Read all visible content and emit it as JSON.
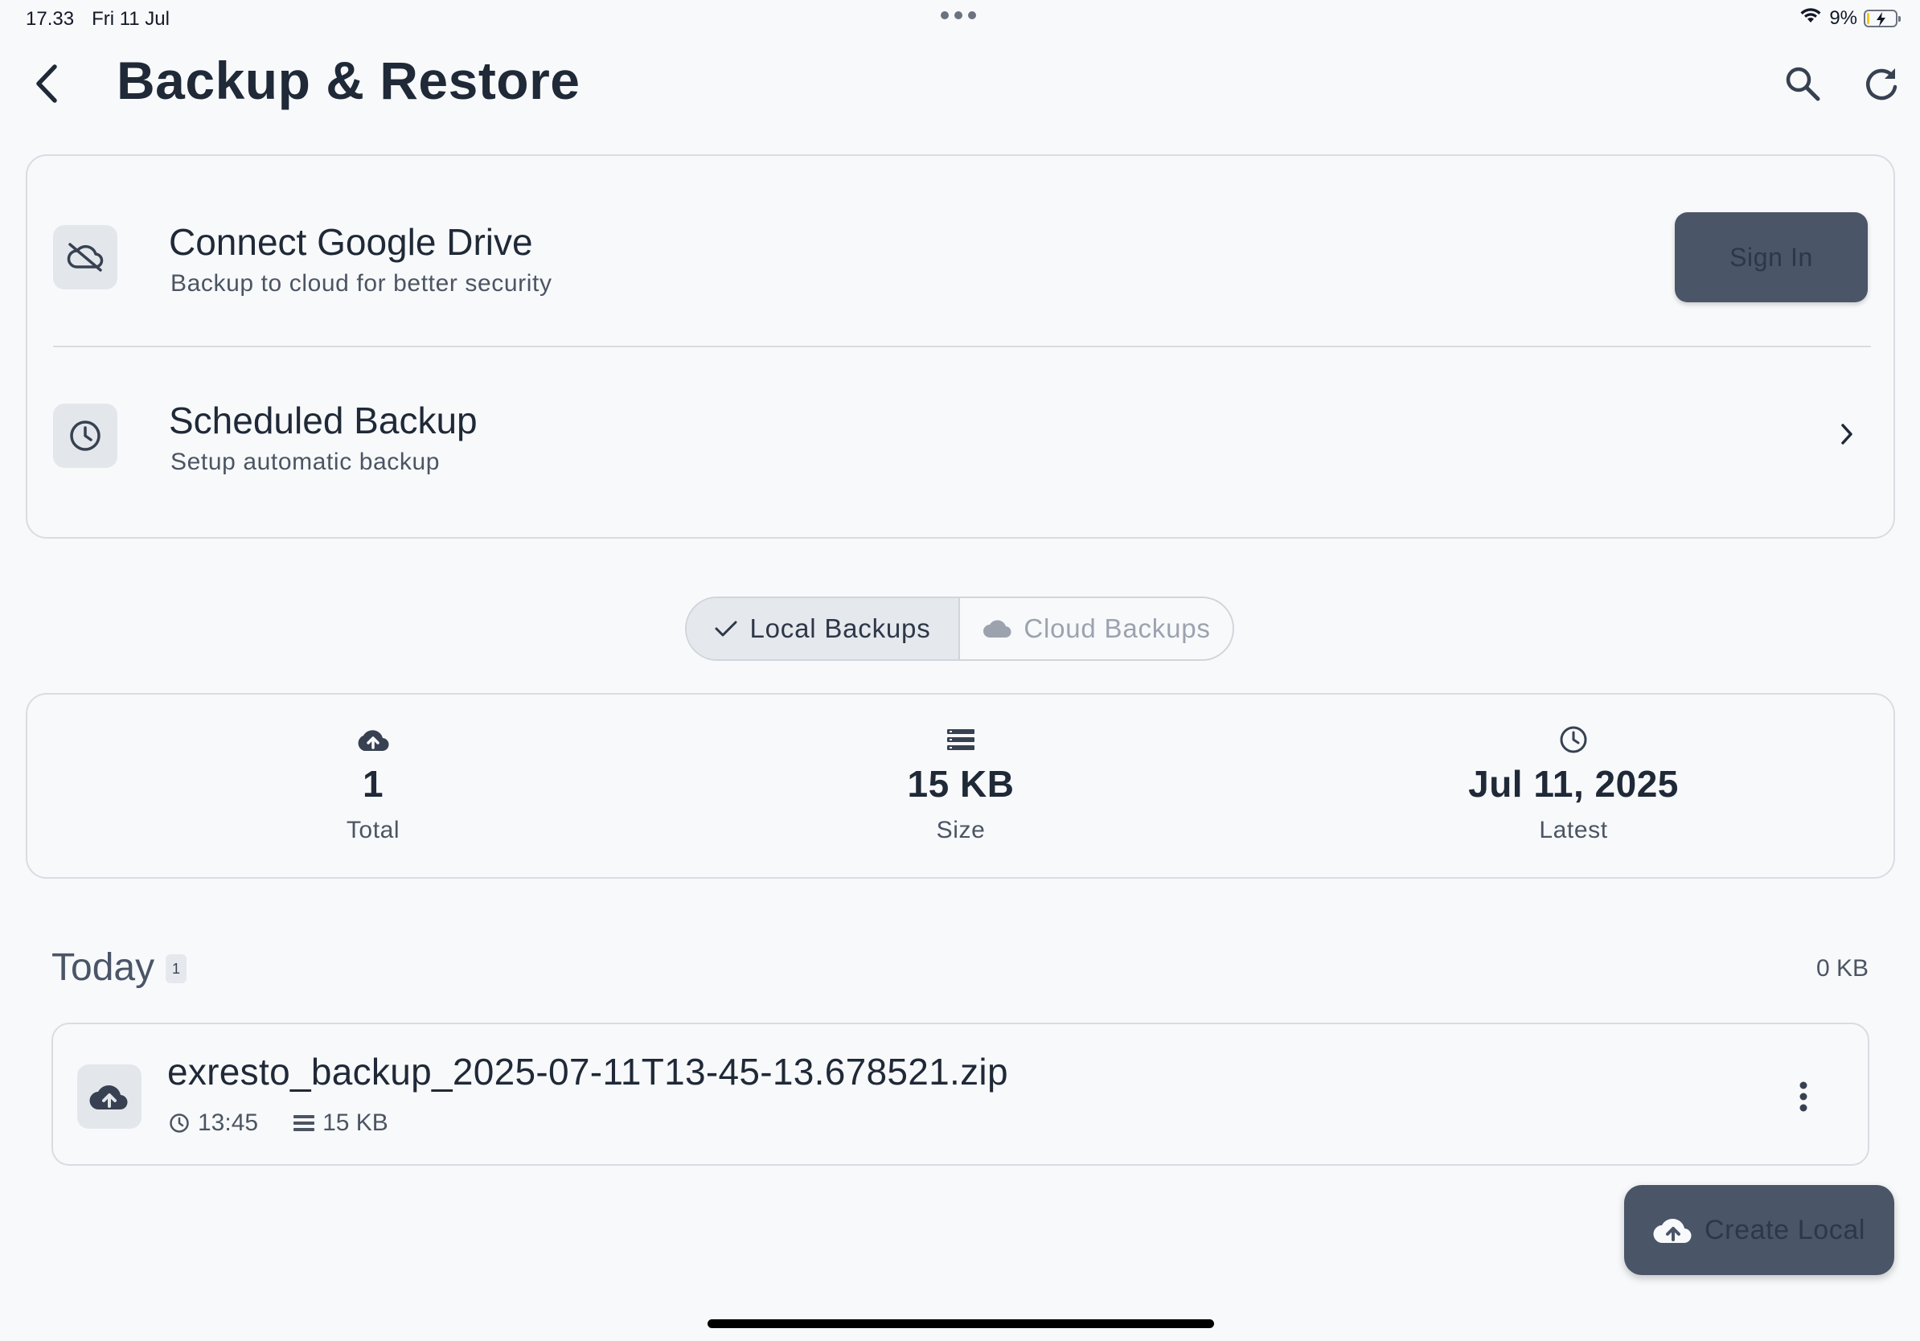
{
  "status_bar": {
    "time": "17.33",
    "date": "Fri 11 Jul",
    "battery": "9%",
    "battery_level": 0.09
  },
  "header": {
    "title": "Backup & Restore",
    "icons": [
      "back-chevron-icon",
      "search-icon",
      "refresh-icon"
    ]
  },
  "settings": {
    "google_drive": {
      "title": "Connect Google Drive",
      "subtitle": "Backup to cloud for better security",
      "button": "Sign In",
      "icon": "cloud-off-icon"
    },
    "scheduled": {
      "title": "Scheduled Backup",
      "subtitle": "Setup automatic backup",
      "icon": "clock-icon"
    }
  },
  "tabs": {
    "local": "Local Backups",
    "cloud": "Cloud Backups",
    "selected": "local"
  },
  "stats": {
    "total": {
      "value": "1",
      "label": "Total"
    },
    "size": {
      "value": "15 KB",
      "label": "Size"
    },
    "latest": {
      "value": "Jul 11, 2025",
      "label": "Latest"
    }
  },
  "groups": [
    {
      "title": "Today",
      "count": "1",
      "size": "0 KB",
      "items": [
        {
          "name": "exresto_backup_2025-07-11T13-45-13.678521.zip",
          "time": "13:45",
          "size": "15 KB"
        }
      ]
    }
  ],
  "fab": {
    "label": "Create Local"
  },
  "colors": {
    "background": "#f8f9fb",
    "primary_button": "#4a5568",
    "text_primary": "#1f2937",
    "text_secondary": "#4b5563",
    "border": "#d8dde3",
    "battery_fill": "#f3c623"
  }
}
